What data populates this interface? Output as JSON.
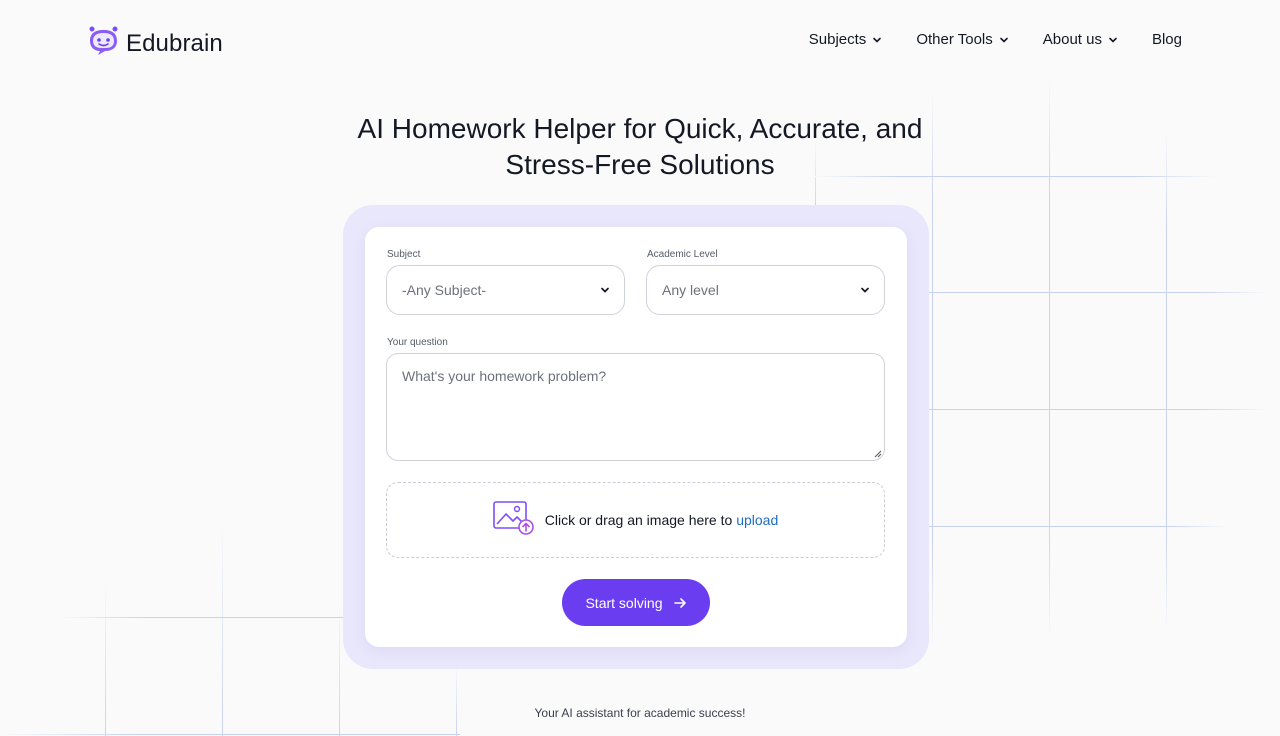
{
  "header": {
    "brand": "Edubrain",
    "nav": [
      {
        "label": "Subjects",
        "has_dropdown": true
      },
      {
        "label": "Other Tools",
        "has_dropdown": true
      },
      {
        "label": "About us",
        "has_dropdown": true
      },
      {
        "label": "Blog",
        "has_dropdown": false
      }
    ]
  },
  "hero": {
    "title_line1": "AI Homework Helper for Quick, Accurate, and",
    "title_line2": "Stress-Free Solutions"
  },
  "form": {
    "subject": {
      "label": "Subject",
      "value": "-Any Subject-"
    },
    "level": {
      "label": "Academic Level",
      "value": "Any level"
    },
    "question": {
      "label": "Your question",
      "placeholder": "What's your homework problem?"
    },
    "upload": {
      "text": "Click or drag an image here to",
      "link": "upload"
    },
    "submit_label": "Start solving"
  },
  "tagline": "Your AI assistant for academic success!",
  "colors": {
    "accent": "#6a3df0",
    "link": "#1f6cc7",
    "card_backdrop": "#e9e7fb"
  }
}
